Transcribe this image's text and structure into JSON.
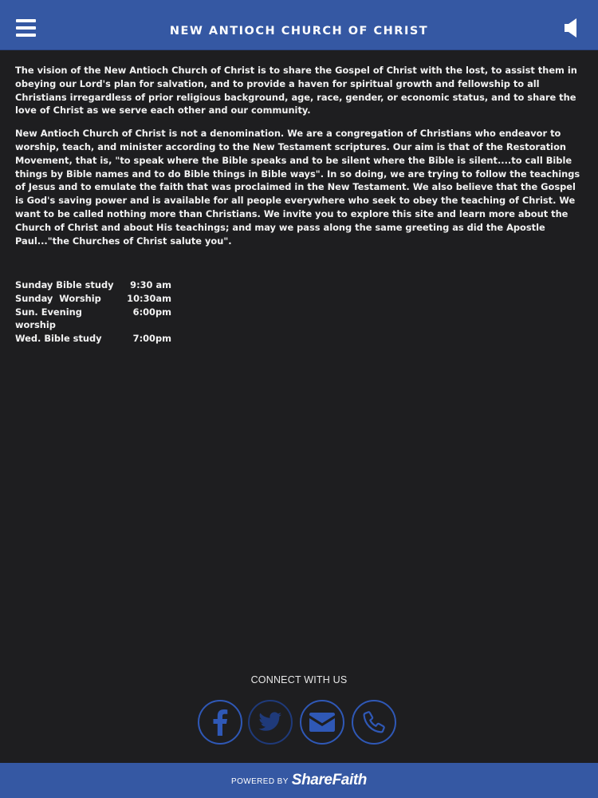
{
  "header": {
    "title": "NEW ANTIOCH CHURCH OF CHRIST",
    "menu_icon": "hamburger-menu-icon",
    "audio_icon": "speaker-icon"
  },
  "content": {
    "paragraphs": [
      "The vision of the New Antioch Church of Christ is to share the Gospel of Christ with the lost, to assist them in obeying our Lord's plan for salvation, and to provide a haven for spiritual growth and fellowship to all Christians irregardless of prior religious background, age, race, gender, or economic status, and to share the love of Christ as we serve each other and our community.",
      "New Antioch Church of Christ is not a denomination. We are a congregation of Christians who endeavor to worship, teach, and minister according to the New Testament scriptures. Our aim is that of the Restoration Movement, that is, \"to speak where the Bible speaks and to be silent where the Bible is silent....to call Bible things by Bible names and to do Bible things in Bible ways\". In so doing, we are trying to follow the teachings of Jesus and to emulate the faith that was proclaimed in the New Testament. We also believe that the Gospel is God's saving power and is available for all people everywhere who seek to obey the teaching of Christ. We want to be called nothing more than Christians. We invite you to explore this site and learn more about the Church of Christ and about His teachings; and may we pass along the same greeting as did the Apostle Paul...\"the Churches of Christ salute you\"."
    ]
  },
  "schedule": [
    {
      "label": "Sunday Bible study",
      "time": "9:30 am"
    },
    {
      "label": "Sunday  Worship",
      "time": "10:30am"
    },
    {
      "label": "Sun. Evening worship",
      "time": "6:00pm"
    },
    {
      "label": "Wed. Bible study",
      "time": "7:00pm"
    }
  ],
  "connect": {
    "label": "CONNECT WITH US",
    "icons": [
      "facebook-icon",
      "twitter-icon",
      "email-icon",
      "phone-icon"
    ]
  },
  "footer": {
    "powered_by": "POWERED BY",
    "brand": "ShareFaith"
  },
  "colors": {
    "header_bg": "#3558a3",
    "page_bg": "#1e1e20",
    "social_ring": "#2f58b6",
    "text": "#ffffff"
  }
}
